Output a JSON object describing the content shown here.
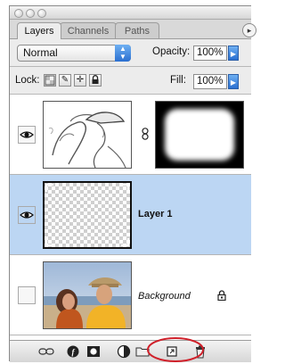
{
  "tabs": [
    {
      "label": "Layers",
      "active": true
    },
    {
      "label": "Channels",
      "active": false
    },
    {
      "label": "Paths",
      "active": false
    }
  ],
  "blend_mode": "Normal",
  "opacity": {
    "label": "Opacity:",
    "value": "100%"
  },
  "lock_label": "Lock:",
  "fill": {
    "label": "Fill:",
    "value": "100%"
  },
  "layers": [
    {
      "name": "",
      "visible": true,
      "selected": false,
      "has_mask": true,
      "linked": true
    },
    {
      "name": "Layer 1",
      "visible": true,
      "selected": true,
      "has_mask": false
    },
    {
      "name": "Background",
      "visible": false,
      "selected": false,
      "locked": true
    }
  ],
  "bottom_icons": [
    "link-layers-icon",
    "layer-style-icon",
    "add-mask-icon",
    "adjustment-layer-icon",
    "new-group-icon",
    "new-layer-icon",
    "trash-icon"
  ],
  "colors": {
    "selection": "#bcd6f3",
    "accent_blue": "#2a6fd0",
    "highlight_circle": "#d0202a"
  }
}
